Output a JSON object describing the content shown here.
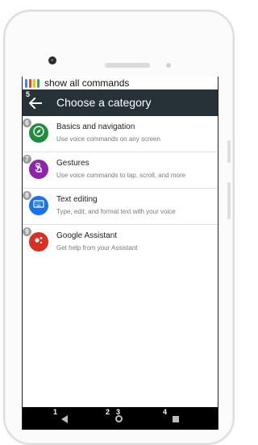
{
  "command_bar": {
    "text": "show all commands",
    "colors": [
      "#4285F4",
      "#EA4335",
      "#FBBC05",
      "#34A853"
    ]
  },
  "header": {
    "number": "5",
    "title": "Choose a category",
    "background": "#263238"
  },
  "categories": [
    {
      "number": "6",
      "title": "Basics and navigation",
      "subtitle": "Use voice commands on any screen",
      "icon": "compass-icon",
      "color": "#1E8E3E"
    },
    {
      "number": "7",
      "title": "Gestures",
      "subtitle": "Use voice commands to tap, scroll, and more",
      "icon": "touch-icon",
      "color": "#8E24AA"
    },
    {
      "number": "8",
      "title": "Text editing",
      "subtitle": "Type, edit, and format text with your voice",
      "icon": "keyboard-icon",
      "color": "#1A73E8"
    },
    {
      "number": "9",
      "title": "Google Assistant",
      "subtitle": "Get help from your Assistant",
      "icon": "assistant-icon",
      "color": "#D93025"
    }
  ],
  "nav": {
    "back_number": "1",
    "home_numbers": [
      "2",
      "3"
    ],
    "recents_number": "4"
  }
}
